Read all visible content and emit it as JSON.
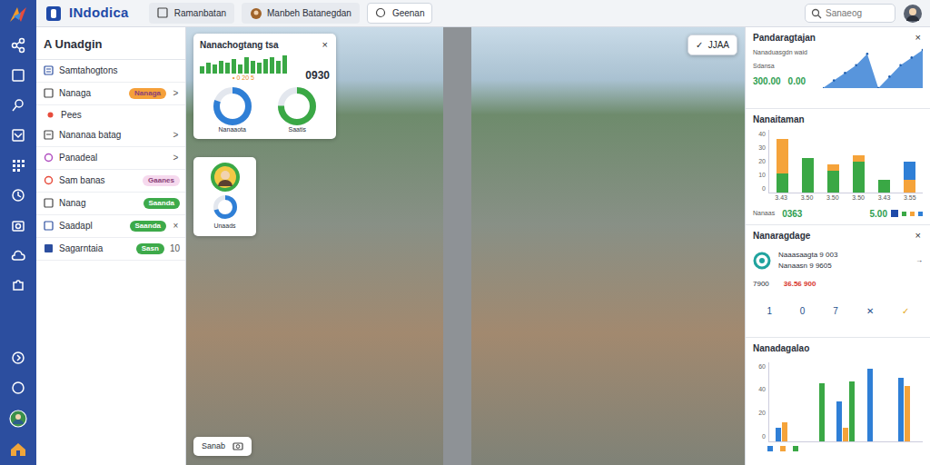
{
  "app": {
    "title": "INdodica"
  },
  "tabs": [
    {
      "label": "Ramanbatan",
      "selected": false
    },
    {
      "label": "Manbeh Batanegdan",
      "selected": false
    },
    {
      "label": "Geenan",
      "selected": true
    }
  ],
  "search": {
    "placeholder": "Sanaeog"
  },
  "left_panel": {
    "title": "A Unadgin",
    "items": [
      {
        "kind": "item",
        "label": "Samtahogtons"
      },
      {
        "kind": "item",
        "label": "Nanaga",
        "badge": "Nanaga",
        "color": "#f5a03a",
        "trail": ">"
      },
      {
        "kind": "sub",
        "label": "Pees"
      },
      {
        "kind": "item",
        "label": "Nananaa batag",
        "trail": ">"
      },
      {
        "kind": "item",
        "label": "Panadeal",
        "trail": ">"
      },
      {
        "kind": "item",
        "label": "Sam banas",
        "badge": "Gaanes",
        "color": "#f6d9ee"
      },
      {
        "kind": "item",
        "label": "Nanag",
        "badge": "Saanda",
        "color": "#3daa4a"
      },
      {
        "kind": "item",
        "label": "Saadapl",
        "badge": "Saanda",
        "color": "#3daa4a",
        "trail": "×"
      },
      {
        "kind": "item",
        "label": "Sagarntaia",
        "badge": "Sasn",
        "color": "#3daa4a",
        "trail": "10"
      }
    ]
  },
  "overlays": {
    "stats_card": {
      "title": "Nanachogtang tsa",
      "close": "×",
      "bars": [
        4,
        6,
        5,
        7,
        6,
        8,
        5,
        9,
        7,
        6,
        8,
        9,
        7,
        10
      ],
      "value": "0930",
      "caption": "• 0 20 5",
      "donuts": [
        {
          "label": "Nanaaota",
          "level": 0.8,
          "color": "#2f7fd6"
        },
        {
          "label": "Saatis",
          "level": 0.75,
          "color": "#3aa845"
        }
      ]
    },
    "profile_card": {
      "label": "Unaads",
      "level": 0.7
    },
    "chip": {
      "label": "Sanab"
    },
    "action": {
      "check": "✓",
      "label": "JJAA"
    }
  },
  "right_panel": {
    "summary": {
      "title": "Pandaragtajan",
      "close": "×",
      "lines": [
        "Nanaduasgdn waid",
        "Sdansa"
      ],
      "value": "300.00",
      "value2": "0.00",
      "values": [
        0,
        2,
        4,
        6,
        9,
        0,
        3,
        6,
        8,
        10
      ]
    },
    "stacked": {
      "title": "Nanaitaman",
      "ticks": [
        "40",
        "30",
        "20",
        "10",
        "0"
      ],
      "labels": [
        "3.43",
        "3.50",
        "3.50",
        "3.50",
        "3.43",
        "3.55"
      ],
      "series": [
        {
          "color": "#3aa845",
          "values": [
            12,
            22,
            14,
            20,
            8,
            0
          ]
        },
        {
          "color": "#f5a33a",
          "values": [
            22,
            0,
            4,
            4,
            0,
            8
          ]
        },
        {
          "color": "#2f7fd6",
          "values": [
            0,
            0,
            0,
            0,
            0,
            12
          ]
        }
      ],
      "footer_left": "Nanaas",
      "footer_value": "0363",
      "footer_right": "5.00"
    },
    "list": {
      "title": "Nanaragdage",
      "close": "×",
      "lines": [
        "Naaasaagta 9 003",
        "Nanaasn 9 9605"
      ],
      "arrow": "→",
      "amount": "7900",
      "delta": "36.56 900",
      "icons": [
        "1",
        "0",
        "7",
        "✕",
        "✓"
      ]
    },
    "grouped": {
      "title": "Nanadagalao",
      "ticks": [
        "60",
        "40",
        "20",
        "0"
      ],
      "series": [
        {
          "color": "#2f7fd6",
          "values": [
            10,
            0,
            30,
            55,
            48
          ]
        },
        {
          "color": "#f5a33a",
          "values": [
            14,
            0,
            10,
            0,
            42
          ]
        },
        {
          "color": "#3aa845",
          "values": [
            0,
            44,
            45,
            0,
            0
          ]
        }
      ]
    }
  }
}
